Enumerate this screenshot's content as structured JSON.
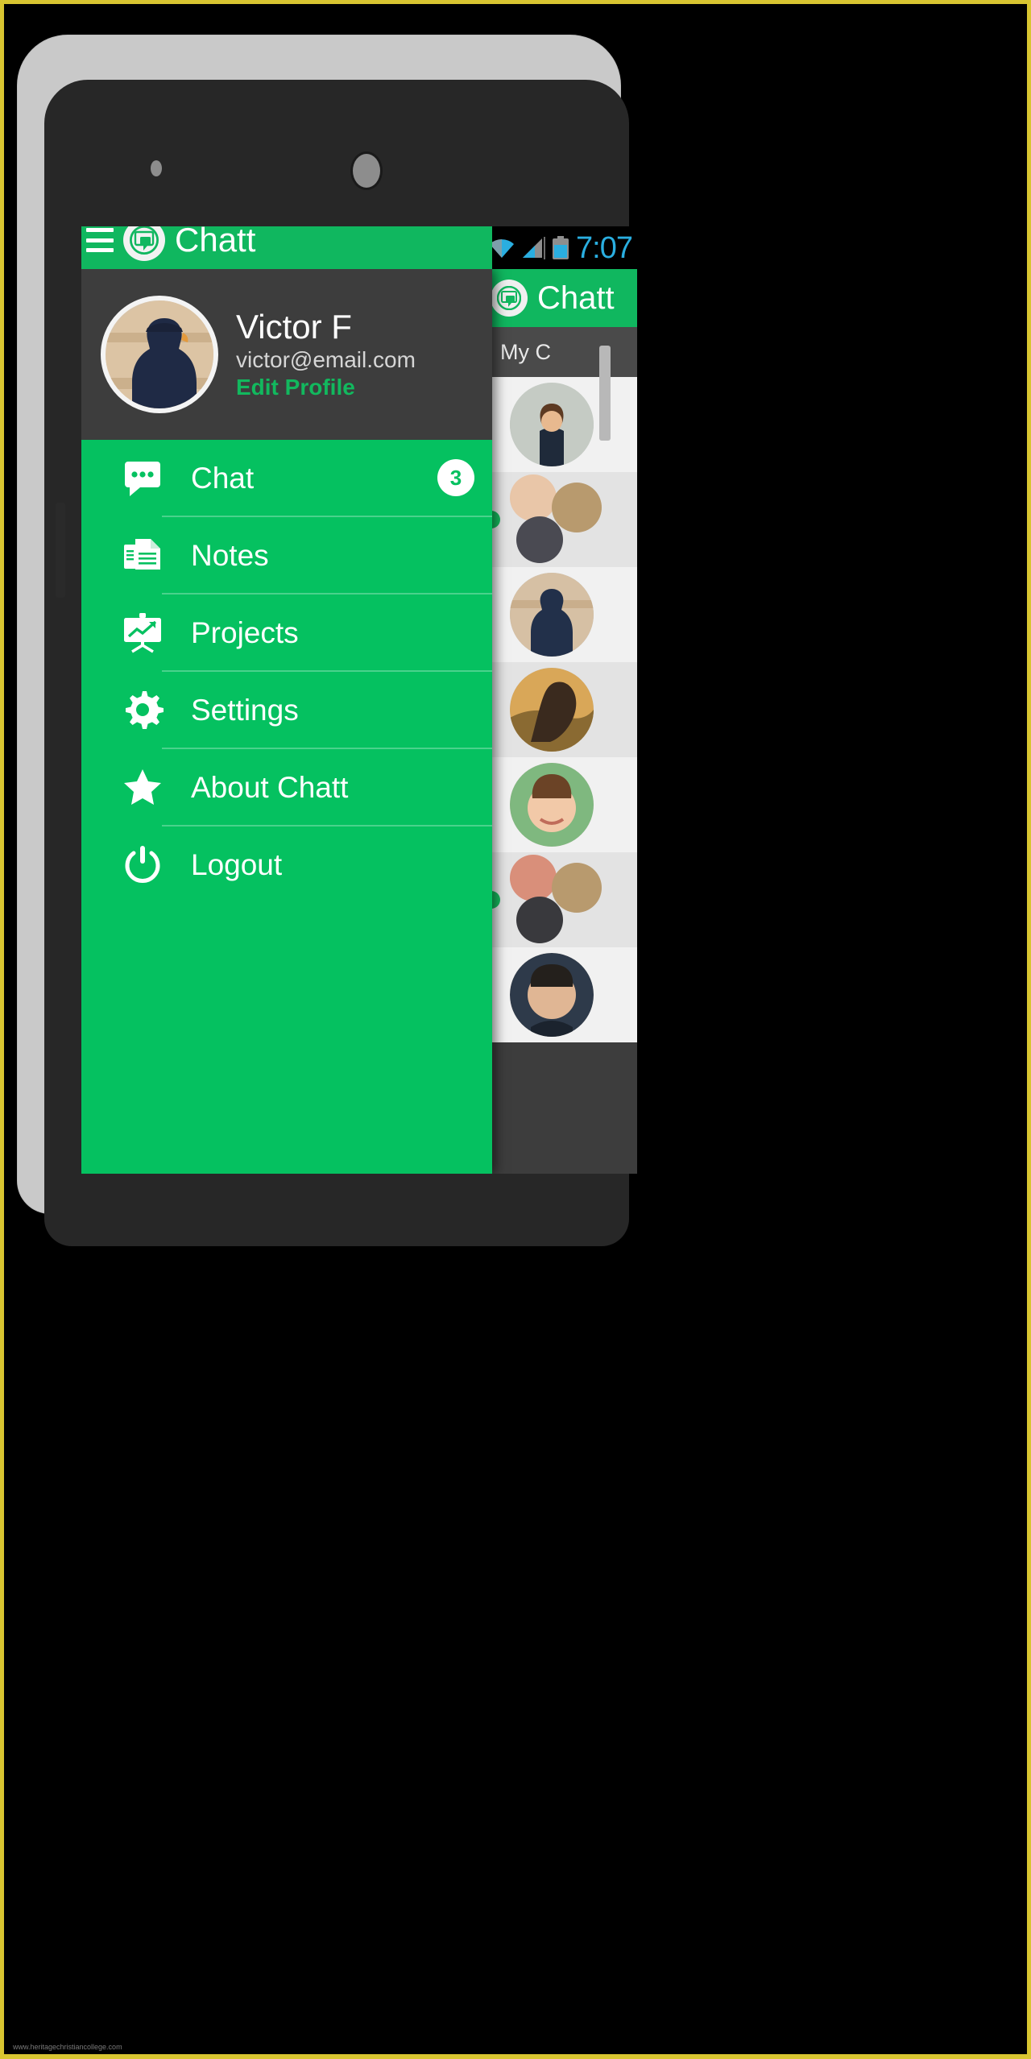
{
  "status_bar": {
    "time": "7:07",
    "icons": [
      "wifi-icon",
      "cell-signal-icon",
      "battery-icon"
    ],
    "accent_color": "#2aaee0"
  },
  "theme": {
    "brand_green": "#05c160",
    "appbar_green": "#10b75f",
    "profile_dark": "#3d3d3d",
    "online_green": "#16b75c"
  },
  "drawer": {
    "app_title": "Chatt",
    "menu_icon": "hamburger-icon",
    "logo_icon": "chat-bubble-logo-icon",
    "profile": {
      "name": "Victor F",
      "email": "victor@email.com",
      "edit_link": "Edit Profile",
      "avatar": "user-avatar-image"
    },
    "items": [
      {
        "label": "Chat",
        "icon": "chat-bubble-dots-icon",
        "badge": "3"
      },
      {
        "label": "Notes",
        "icon": "documents-stack-icon",
        "badge": ""
      },
      {
        "label": "Projects",
        "icon": "presentation-chart-icon",
        "badge": ""
      },
      {
        "label": "Settings",
        "icon": "gear-icon",
        "badge": ""
      },
      {
        "label": "About Chatt",
        "icon": "star-icon",
        "badge": ""
      },
      {
        "label": "Logout",
        "icon": "power-icon",
        "badge": ""
      }
    ]
  },
  "chat_list": {
    "app_title": "Chatt",
    "logo_icon": "chat-bubble-logo-icon",
    "tab_label": "My C",
    "rows": [
      {
        "online": false,
        "type": "single",
        "avatar": "avatar-young-man"
      },
      {
        "online": true,
        "type": "group",
        "avatar": "avatar-group-three"
      },
      {
        "online": false,
        "type": "single",
        "avatar": "avatar-man-beach"
      },
      {
        "online": false,
        "type": "single",
        "avatar": "avatar-woman-sunset"
      },
      {
        "online": false,
        "type": "single",
        "avatar": "avatar-smiling-woman"
      },
      {
        "online": true,
        "type": "group",
        "avatar": "avatar-group-three-2"
      },
      {
        "online": false,
        "type": "single",
        "avatar": "avatar-man-portrait"
      }
    ]
  },
  "watermark": "www.heritagechristiancollege.com"
}
